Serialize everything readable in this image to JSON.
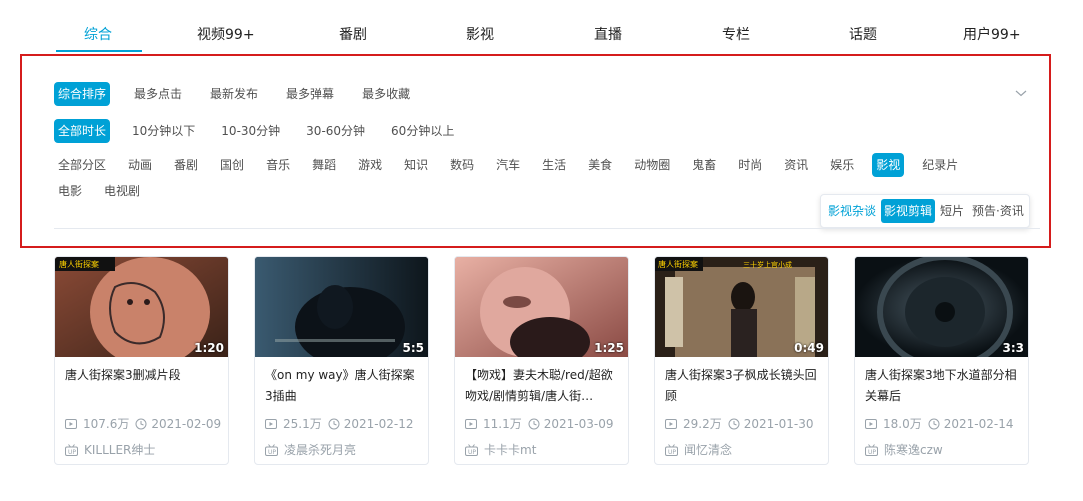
{
  "tabs": [
    {
      "label": "综合"
    },
    {
      "label": "视频99+"
    },
    {
      "label": "番剧"
    },
    {
      "label": "影视"
    },
    {
      "label": "直播"
    },
    {
      "label": "专栏"
    },
    {
      "label": "话题"
    },
    {
      "label": "用户99+"
    }
  ],
  "active_tab": "综合",
  "filters": {
    "order": [
      "综合排序",
      "最多点击",
      "最新发布",
      "最多弹幕",
      "最多收藏"
    ],
    "order_selected": "综合排序",
    "duration": [
      "全部时长",
      "10分钟以下",
      "10-30分钟",
      "30-60分钟",
      "60分钟以上"
    ],
    "duration_selected": "全部时长",
    "partitions": [
      "全部分区",
      "动画",
      "番剧",
      "国创",
      "音乐",
      "舞蹈",
      "游戏",
      "知识",
      "数码",
      "汽车",
      "生活",
      "美食",
      "动物圈",
      "鬼畜",
      "时尚",
      "资讯",
      "娱乐",
      "影视",
      "纪录片",
      "电影",
      "电视剧"
    ],
    "partition_selected": "影视",
    "sub_partitions": [
      "影视杂谈",
      "影视剪辑",
      "短片",
      "预告·资讯"
    ],
    "sub_selected": "影视剪辑"
  },
  "videos": [
    {
      "duration": "1:20",
      "title": "唐人街探案3删减片段",
      "plays": "107.6万",
      "date": "2021-02-09",
      "uploader": "KILLLER绅士"
    },
    {
      "duration": "5:5",
      "title": "《on my way》唐人街探案3插曲",
      "plays": "25.1万",
      "date": "2021-02-12",
      "uploader": "凌晨杀死月亮"
    },
    {
      "duration": "1:25",
      "title": "【吻戏】妻夫木聪/red/超欲吻戏/剧情剪辑/唐人街…",
      "plays": "11.1万",
      "date": "2021-03-09",
      "uploader": "卡卡卡mt"
    },
    {
      "duration": "0:49",
      "title": "唐人街探案3子枫成长镜头回顾",
      "plays": "29.2万",
      "date": "2021-01-30",
      "uploader": "闻忆清念"
    },
    {
      "duration": "3:3",
      "title": "唐人街探案3地下水道部分相关幕后",
      "plays": "18.0万",
      "date": "2021-02-14",
      "uploader": "陈寒逸czw"
    }
  ],
  "colors": {
    "accent": "#00a1d6",
    "highlight_box": "#d51c1c",
    "meta_gray": "#99a2aa"
  }
}
